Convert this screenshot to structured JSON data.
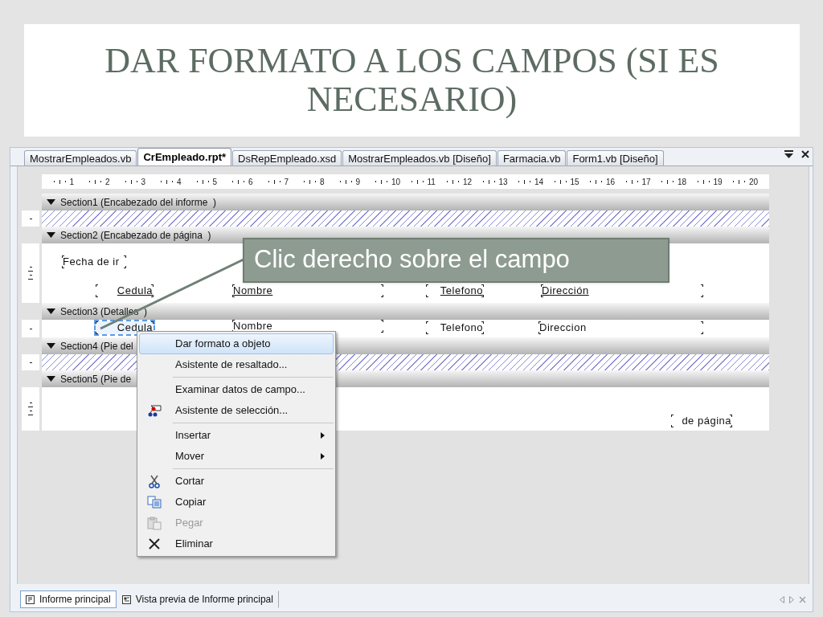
{
  "slide_title": "DAR FORMATO A LOS CAMPOS (SI ES NECESARIO)",
  "tabs": [
    {
      "label": "MostrarEmpleados.vb",
      "selected": false
    },
    {
      "label": "CrEmpleado.rpt*",
      "selected": true
    },
    {
      "label": "DsRepEmpleado.xsd",
      "selected": false
    },
    {
      "label": "MostrarEmpleados.vb [Diseño]",
      "selected": false
    },
    {
      "label": "Farmacia.vb",
      "selected": false
    },
    {
      "label": "Form1.vb [Diseño]",
      "selected": false
    }
  ],
  "ruler": [
    "1",
    "2",
    "3",
    "4",
    "5",
    "6",
    "7",
    "8",
    "9",
    "10",
    "11",
    "12",
    "13",
    "14",
    "15",
    "16",
    "17",
    "18",
    "19",
    "20"
  ],
  "sections": [
    {
      "label": "Section1 (Encabezado del informe  )",
      "kind": "suppressed"
    },
    {
      "label": "Section2 (Encabezado de página  )",
      "kind": "visible",
      "fields": [
        {
          "text": "Fecha de ir",
          "kind": "text",
          "selected": false
        },
        {
          "text": "Cedula",
          "kind": "heading",
          "selected": false
        },
        {
          "text": "Nombre",
          "kind": "heading",
          "selected": false
        },
        {
          "text": "Telefono",
          "kind": "heading",
          "selected": false
        },
        {
          "text": "Dirección",
          "kind": "heading",
          "selected": false
        }
      ]
    },
    {
      "label": "Section3 (Detalles  )",
      "kind": "visible",
      "fields": [
        {
          "text": "Cedula",
          "kind": "data",
          "selected": true
        },
        {
          "text": "Nombre",
          "kind": "data",
          "selected": false
        },
        {
          "text": "Telefono",
          "kind": "data",
          "selected": false
        },
        {
          "text": "Direccion",
          "kind": "data",
          "selected": false
        }
      ]
    },
    {
      "label": "Section4 (Pie del",
      "kind": "suppressed"
    },
    {
      "label": "Section5 (Pie de",
      "kind": "visible",
      "fields": [
        {
          "text": "de página",
          "kind": "text",
          "selected": false
        }
      ]
    }
  ],
  "callout": "Clic derecho sobre el campo",
  "context_menu": [
    {
      "kind": "item",
      "label": "Dar formato a objeto",
      "selected": true,
      "disabled": false,
      "submenu": false
    },
    {
      "kind": "item",
      "label": "Asistente de resaltado...",
      "selected": false,
      "disabled": false,
      "submenu": false
    },
    {
      "kind": "separator"
    },
    {
      "kind": "item",
      "label": "Examinar datos de campo...",
      "selected": false,
      "disabled": false,
      "submenu": false
    },
    {
      "kind": "item",
      "label": "Asistente de selección...",
      "selected": false,
      "disabled": false,
      "submenu": false
    },
    {
      "kind": "separator"
    },
    {
      "kind": "item",
      "label": "Insertar",
      "selected": false,
      "disabled": false,
      "submenu": true
    },
    {
      "kind": "item",
      "label": "Mover",
      "selected": false,
      "disabled": false,
      "submenu": true
    },
    {
      "kind": "separator"
    },
    {
      "kind": "item",
      "label": "Cortar",
      "selected": false,
      "disabled": false,
      "submenu": false
    },
    {
      "kind": "item",
      "label": "Copiar",
      "selected": false,
      "disabled": false,
      "submenu": false
    },
    {
      "kind": "item",
      "label": "Pegar",
      "selected": false,
      "disabled": true,
      "submenu": false
    },
    {
      "kind": "item",
      "label": "Eliminar",
      "selected": false,
      "disabled": false,
      "submenu": false
    }
  ],
  "bottom_tabs": [
    {
      "label": "Informe principal",
      "selected": true
    },
    {
      "label": "Vista previa de Informe principal",
      "selected": false
    }
  ]
}
